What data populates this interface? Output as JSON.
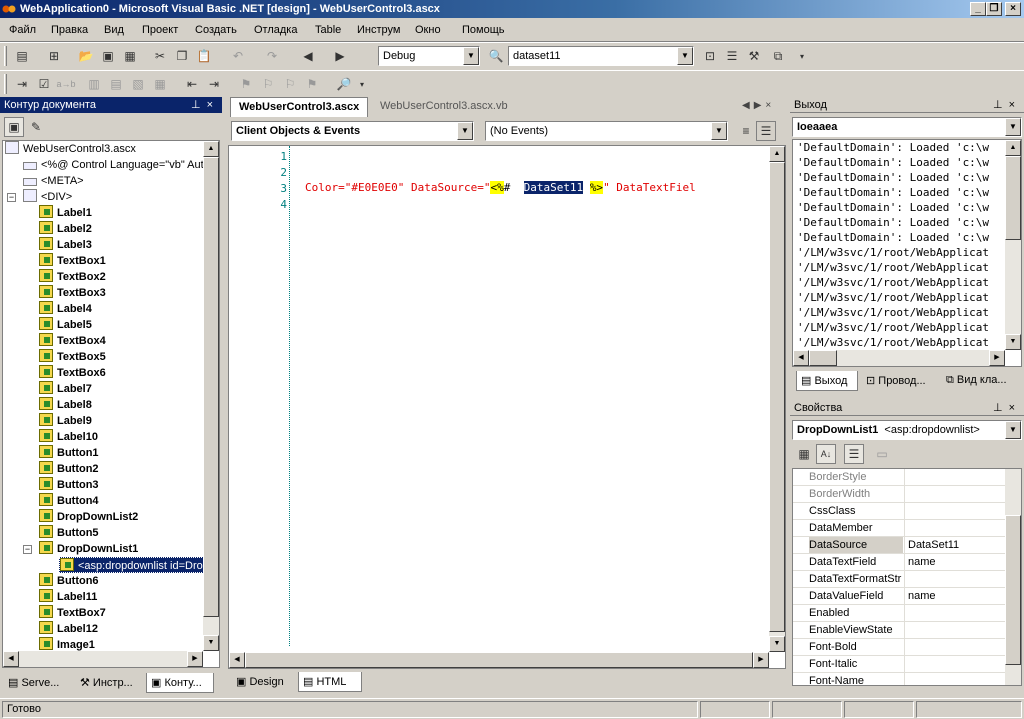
{
  "window": {
    "title": "WebApplication0 - Microsoft Visual Basic .NET [design] - WebUserControl3.ascx"
  },
  "menu": [
    "Файл",
    "Правка",
    "Вид",
    "Проект",
    "Создать",
    "Отладка",
    "Table",
    "Инструм",
    "Окно",
    "Помощь"
  ],
  "toolbar": {
    "config": "Debug",
    "solution_combo": "dataset11"
  },
  "doc_outline": {
    "title": "Контур документа",
    "items": {
      "root": "WebUserControl3.ascx",
      "directive": "<%@ Control Language=\"vb\" Aut",
      "meta": "<META>",
      "div": "<DIV>",
      "controls": [
        "Label1",
        "Label2",
        "Label3",
        "TextBox1",
        "TextBox2",
        "TextBox3",
        "Label4",
        "Label5",
        "TextBox4",
        "TextBox5",
        "TextBox6",
        "Label7",
        "Label8",
        "Label9",
        "Label10",
        "Button1",
        "Button2",
        "Button3",
        "Button4",
        "DropDownList2",
        "Button5",
        "DropDownList1"
      ],
      "child": "<asp:dropdownlist id=Dro",
      "after": [
        "Button6",
        "Label11",
        "TextBox7",
        "Label12",
        "Image1"
      ]
    },
    "tabs": [
      "Serve...",
      "Инстр...",
      "Конту..."
    ]
  },
  "editor": {
    "tabs": [
      "WebUserControl3.ascx",
      "WebUserControl3.ascx.vb"
    ],
    "objects_combo": "Client Objects & Events",
    "events_combo": "(No Events)",
    "line_numbers": [
      "1",
      "2",
      "3",
      "4"
    ],
    "line3": {
      "attr1": "Color=\"#E0E0E0\"",
      "attr2": "DataSource=\"",
      "open": "<%",
      "hash": "# ",
      "ds": "DataSet11",
      "close": "%>",
      "rest": "\" DataTextFiel"
    },
    "bottom_tabs": [
      "Design",
      "HTML"
    ]
  },
  "output": {
    "title": "Выход",
    "combo": "Ioeaaea",
    "lines": [
      "'DefaultDomain': Loaded 'c:\\w",
      "'DefaultDomain': Loaded 'c:\\w",
      "'DefaultDomain': Loaded 'c:\\w",
      "'DefaultDomain': Loaded 'c:\\w",
      "'DefaultDomain': Loaded 'c:\\w",
      "'DefaultDomain': Loaded 'c:\\w",
      "'DefaultDomain': Loaded 'c:\\w",
      "'/LM/w3svc/1/root/WebApplicat",
      "'/LM/w3svc/1/root/WebApplicat",
      "'/LM/w3svc/1/root/WebApplicat",
      "'/LM/w3svc/1/root/WebApplicat",
      "'/LM/w3svc/1/root/WebApplicat",
      "'/LM/w3svc/1/root/WebApplicat",
      "'/LM/w3svc/1/root/WebApplicat"
    ],
    "tabs": [
      "Выход",
      "Провод...",
      "Вид кла..."
    ]
  },
  "properties": {
    "title": "Свойства",
    "object": "DropDownList1",
    "object_type": "<asp:dropdownlist>",
    "rows": [
      {
        "name": "BorderStyle",
        "value": ""
      },
      {
        "name": "BorderWidth",
        "value": ""
      },
      {
        "name": "CssClass",
        "value": ""
      },
      {
        "name": "DataMember",
        "value": ""
      },
      {
        "name": "DataSource",
        "value": "DataSet11"
      },
      {
        "name": "DataTextField",
        "value": "name"
      },
      {
        "name": "DataTextFormatStr",
        "value": ""
      },
      {
        "name": "DataValueField",
        "value": "name"
      },
      {
        "name": "Enabled",
        "value": ""
      },
      {
        "name": "EnableViewState",
        "value": ""
      },
      {
        "name": "Font-Bold",
        "value": ""
      },
      {
        "name": "Font-Italic",
        "value": ""
      },
      {
        "name": "Font-Name",
        "value": ""
      }
    ]
  },
  "status": {
    "text": "Готово"
  }
}
